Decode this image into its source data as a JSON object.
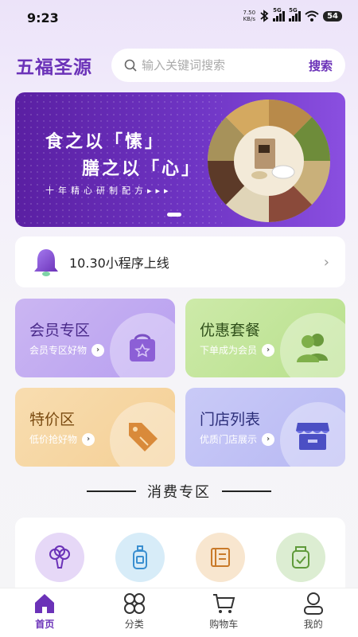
{
  "status_bar": {
    "time": "9:23",
    "net_speed_value": "7.50",
    "net_speed_unit": "KB/s",
    "signal1_label": "5G",
    "signal2_label": "5G",
    "battery": "54"
  },
  "header": {
    "brand": "五福圣源",
    "search_placeholder": "输入关键词搜索",
    "search_button": "搜索"
  },
  "banner": {
    "line1": "食之以「愫」",
    "line2": "膳之以「心」",
    "subtitle": "十年精心研制配方▸▸▸"
  },
  "notice": {
    "text": "10.30小程序上线"
  },
  "cards": [
    {
      "title": "会员专区",
      "subtitle": "会员专区好物",
      "icon": "shopping-bag-star-icon"
    },
    {
      "title": "优惠套餐",
      "subtitle": "下单成为会员",
      "icon": "users-icon"
    },
    {
      "title": "特价区",
      "subtitle": "低价抢好物",
      "icon": "price-tag-icon"
    },
    {
      "title": "门店列表",
      "subtitle": "优质门店展示",
      "icon": "store-icon"
    }
  ],
  "section": {
    "title": "消费专区"
  },
  "categories": [
    {
      "icon": "broccoli-icon"
    },
    {
      "icon": "bottle-icon"
    },
    {
      "icon": "book-icon"
    },
    {
      "icon": "jar-icon"
    }
  ],
  "tabs": [
    {
      "label": "首页",
      "icon": "home-icon",
      "active": true
    },
    {
      "label": "分类",
      "icon": "category-icon",
      "active": false
    },
    {
      "label": "购物车",
      "icon": "cart-icon",
      "active": false
    },
    {
      "label": "我的",
      "icon": "profile-icon",
      "active": false
    }
  ],
  "colors": {
    "brand": "#6b32b8",
    "banner_bg": "#6f35c4",
    "member_card": "#c3aef2",
    "promo_card": "#c4e69c",
    "special_card": "#f6d7a3",
    "stores_card": "#c0c1f5"
  }
}
